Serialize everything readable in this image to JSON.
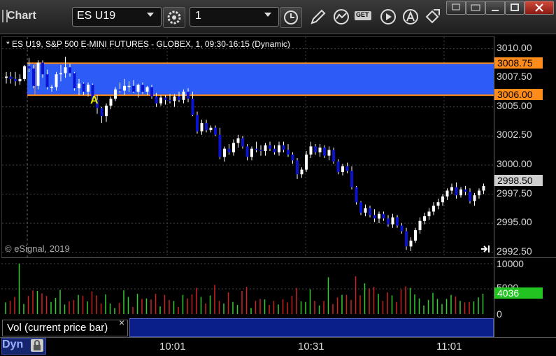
{
  "app": {
    "title": "Chart"
  },
  "toolbar": {
    "symbol": "ES U19",
    "interval": "1",
    "get_label": "GET"
  },
  "chart": {
    "header": "* ES U19, S&P 500 E-MINI FUTURES - GLOBEX, 1, 09:30-16:15 (Dynamic)",
    "watermark": "© eSignal, 2019",
    "marker": "A",
    "price_labels": [
      "3010.00",
      "3007.50",
      "3005.00",
      "3002.50",
      "3000.00",
      "2997.50",
      "2995.00",
      "2992.50"
    ],
    "band_top_tag": "3008.75",
    "band_bottom_tag": "3006.00",
    "last_price_tag": "2998.50",
    "colors": {
      "band": "#2c5cf5",
      "band_edge": "#ff8c1a",
      "up": "#ffffff",
      "down": "#0a14d0"
    }
  },
  "volume": {
    "study_label": "Vol (current price bar)",
    "close_glyph": "×",
    "labels": [
      "10000",
      "5000",
      "0"
    ],
    "last_tag": "4036",
    "colors": {
      "up": "#33cc33",
      "down": "#cc2222",
      "tag": "#22c422"
    }
  },
  "footer": {
    "dyn": "Dyn",
    "times": [
      "10:01",
      "10:31",
      "11:01"
    ]
  },
  "chart_data": {
    "type": "candlestick",
    "series": [
      {
        "values": [
          [
            3007.5,
            3008.0,
            3007.0,
            3007.6
          ],
          [
            3007.6,
            3008.0,
            3007.0,
            3007.4
          ],
          [
            3007.4,
            3008.0,
            3006.8,
            3007.2
          ],
          [
            3007.2,
            3007.8,
            3006.9,
            3007.4
          ],
          [
            3007.4,
            3008.6,
            3007.2,
            3008.5
          ],
          [
            3008.5,
            3009.2,
            3008.0,
            3008.3
          ],
          [
            3008.3,
            3008.6,
            3006.6,
            3006.8
          ],
          [
            3006.8,
            3009.0,
            3006.5,
            3008.8
          ],
          [
            3008.8,
            3009.0,
            3007.5,
            3007.8
          ],
          [
            3007.8,
            3008.2,
            3006.5,
            3006.7
          ],
          [
            3006.7,
            3006.9,
            3006.3,
            3006.7
          ],
          [
            3006.7,
            3008.0,
            3006.4,
            3007.8
          ],
          [
            3007.8,
            3008.6,
            3007.2,
            3007.9
          ],
          [
            3007.9,
            3009.3,
            3007.5,
            3008.4
          ],
          [
            3008.4,
            3008.7,
            3007.6,
            3007.9
          ],
          [
            3007.9,
            3008.0,
            3006.4,
            3006.6
          ],
          [
            3006.6,
            3007.4,
            3006.0,
            3007.0
          ],
          [
            3007.0,
            3007.1,
            3006.0,
            3006.3
          ],
          [
            3006.3,
            3007.1,
            3005.9,
            3006.9
          ],
          [
            3006.9,
            3007.0,
            3005.5,
            3005.6
          ],
          [
            3005.6,
            3006.0,
            3004.4,
            3004.9
          ],
          [
            3004.9,
            3005.0,
            3003.6,
            3004.2
          ],
          [
            3004.2,
            3005.3,
            3003.7,
            3005.1
          ],
          [
            3005.1,
            3005.9,
            3004.8,
            3005.7
          ],
          [
            3005.7,
            3006.7,
            3005.5,
            3006.5
          ],
          [
            3006.5,
            3007.1,
            3006.2,
            3006.4
          ],
          [
            3006.4,
            3007.4,
            3006.0,
            3006.8
          ],
          [
            3006.8,
            3007.2,
            3006.3,
            3006.8
          ],
          [
            3006.8,
            3007.3,
            3006.2,
            3006.3
          ],
          [
            3006.3,
            3007.0,
            3005.8,
            3006.9
          ],
          [
            3006.9,
            3007.1,
            3006.1,
            3006.3
          ],
          [
            3006.3,
            3006.8,
            3006.0,
            3006.7
          ],
          [
            3006.7,
            3006.9,
            3005.7,
            3005.9
          ],
          [
            3005.9,
            3006.2,
            3005.0,
            3005.3
          ],
          [
            3005.3,
            3006.0,
            3005.1,
            3005.8
          ],
          [
            3005.8,
            3006.0,
            3005.2,
            3005.6
          ],
          [
            3005.6,
            3006.1,
            3005.3,
            3005.5
          ],
          [
            3005.5,
            3006.1,
            3005.0,
            3005.9
          ],
          [
            3005.9,
            3006.3,
            3005.4,
            3005.6
          ],
          [
            3005.6,
            3006.5,
            3005.3,
            3006.3
          ],
          [
            3006.3,
            3006.6,
            3005.4,
            3005.7
          ],
          [
            3005.7,
            3006.3,
            3004.2,
            3004.3
          ],
          [
            3004.3,
            3004.6,
            3002.7,
            3002.9
          ],
          [
            3002.9,
            3003.9,
            3002.6,
            3003.6
          ],
          [
            3003.6,
            3003.9,
            3002.8,
            3003.0
          ],
          [
            3003.0,
            3003.4,
            3002.8,
            3003.2
          ],
          [
            3003.2,
            3003.4,
            3002.5,
            3002.6
          ],
          [
            3002.6,
            3003.2,
            3000.5,
            3000.7
          ],
          [
            3000.7,
            3001.6,
            3000.3,
            3001.4
          ],
          [
            3001.4,
            3001.8,
            3000.9,
            3001.1
          ],
          [
            3001.1,
            3002.2,
            3000.8,
            3001.9
          ],
          [
            3001.9,
            3002.6,
            3001.5,
            3002.3
          ],
          [
            3002.3,
            3002.5,
            3001.4,
            3001.6
          ],
          [
            3001.6,
            3001.8,
            3000.4,
            3000.7
          ],
          [
            3000.7,
            3001.6,
            3000.4,
            3001.4
          ],
          [
            3001.4,
            3002.0,
            3001.1,
            3001.3
          ],
          [
            3001.3,
            3001.7,
            3000.8,
            3001.2
          ],
          [
            3001.2,
            3001.9,
            3000.8,
            3001.7
          ],
          [
            3001.7,
            3002.0,
            3001.2,
            3001.4
          ],
          [
            3001.4,
            3001.7,
            3000.9,
            3001.1
          ],
          [
            3001.1,
            3002.0,
            3000.8,
            3001.7
          ],
          [
            3001.7,
            3002.0,
            3001.1,
            3001.3
          ],
          [
            3001.3,
            3001.8,
            3000.7,
            3000.9
          ],
          [
            3000.9,
            3001.1,
            3000.1,
            3000.4
          ],
          [
            3000.4,
            3000.6,
            2998.8,
            2999.2
          ],
          [
            2999.2,
            2999.8,
            2998.9,
            2999.6
          ],
          [
            2999.6,
            3001.2,
            2999.4,
            3000.9
          ],
          [
            3000.9,
            3002.0,
            3000.6,
            3001.6
          ],
          [
            3001.6,
            3001.8,
            3000.9,
            3001.1
          ],
          [
            3001.1,
            3001.8,
            3000.7,
            3001.5
          ],
          [
            3001.5,
            3001.7,
            3000.6,
            3000.8
          ],
          [
            3000.8,
            3001.6,
            3000.4,
            3001.3
          ],
          [
            3001.3,
            3001.5,
            3000.1,
            3000.3
          ],
          [
            3000.3,
            3000.5,
            2999.2,
            2999.4
          ],
          [
            2999.4,
            3000.1,
            2999.1,
            2999.9
          ],
          [
            2999.9,
            3000.2,
            2999.3,
            2999.5
          ],
          [
            2999.5,
            2999.9,
            2997.9,
            2998.1
          ],
          [
            2998.1,
            2998.2,
            2996.6,
            2996.8
          ],
          [
            2996.8,
            2996.9,
            2995.7,
            2995.9
          ],
          [
            2995.9,
            2996.6,
            2995.6,
            2996.3
          ],
          [
            2996.3,
            2996.5,
            2995.5,
            2995.7
          ],
          [
            2995.7,
            2996.2,
            2995.1,
            2995.4
          ],
          [
            2995.4,
            2996.0,
            2995.0,
            2995.8
          ],
          [
            2995.8,
            2996.0,
            2995.2,
            2995.4
          ],
          [
            2995.4,
            2995.7,
            2994.7,
            2994.9
          ],
          [
            2994.9,
            2995.8,
            2994.6,
            2995.5
          ],
          [
            2995.5,
            2995.7,
            2994.6,
            2994.8
          ],
          [
            2994.8,
            2995.0,
            2994.1,
            2994.3
          ],
          [
            2994.3,
            2994.6,
            2992.7,
            2993.0
          ],
          [
            2993.0,
            2993.8,
            2992.6,
            2993.5
          ],
          [
            2993.5,
            2994.6,
            2993.3,
            2994.4
          ],
          [
            2994.4,
            2995.5,
            2994.1,
            2995.2
          ],
          [
            2995.2,
            2995.9,
            2994.9,
            2995.6
          ],
          [
            2995.6,
            2996.3,
            2995.3,
            2996.0
          ],
          [
            2996.0,
            2996.8,
            2995.7,
            2996.5
          ],
          [
            2996.5,
            2997.1,
            2996.2,
            2996.8
          ],
          [
            2996.8,
            2997.5,
            2996.5,
            2997.3
          ],
          [
            2997.3,
            2998.0,
            2997.0,
            2997.8
          ],
          [
            2997.8,
            2998.4,
            2997.5,
            2998.1
          ],
          [
            2998.1,
            2998.5,
            2997.1,
            2997.4
          ],
          [
            2997.4,
            2998.1,
            2997.2,
            2997.9
          ],
          [
            2997.9,
            2998.2,
            2997.4,
            2997.7
          ],
          [
            2997.7,
            2998.0,
            2996.7,
            2996.9
          ],
          [
            2996.9,
            2997.6,
            2996.5,
            2997.4
          ],
          [
            2997.4,
            2998.0,
            2997.1,
            2997.8
          ],
          [
            2997.8,
            2998.4,
            2997.5,
            2998.2
          ]
        ]
      }
    ],
    "volume": [
      2300,
      2600,
      3400,
      10000,
      2000,
      3600,
      4700,
      4600,
      4100,
      3600,
      2400,
      3200,
      4800,
      1900,
      2500,
      2800,
      3800,
      3600,
      2500,
      4500,
      3700,
      2100,
      3900,
      2100,
      1200,
      2200,
      4700,
      3400,
      1400,
      4000,
      3000,
      3100,
      2900,
      4000,
      1500,
      3800,
      2800,
      2600,
      1400,
      3800,
      3100,
      3900,
      5200,
      3400,
      2100,
      3700,
      5800,
      2600,
      2100,
      4300,
      2400,
      1800,
      4600,
      5400,
      1200,
      2600,
      3000,
      2900,
      1800,
      2600,
      1900,
      2900,
      2300,
      3600,
      5200,
      2500,
      2400,
      4900,
      2600,
      1700,
      2600,
      7300,
      2000,
      3300,
      3800,
      3800,
      2800,
      7500,
      3700,
      6100,
      5100,
      5400,
      4000,
      2600,
      4300,
      3700,
      2400,
      4900,
      5500,
      5200,
      3900,
      3100,
      1700,
      2800,
      4200,
      3000,
      2000,
      3000,
      3800,
      3500,
      2600,
      2300,
      2400,
      2500,
      3300,
      4036
    ],
    "ylim": [
      2992.0,
      3011.0
    ],
    "band": [
      3006.0,
      3008.75
    ]
  }
}
